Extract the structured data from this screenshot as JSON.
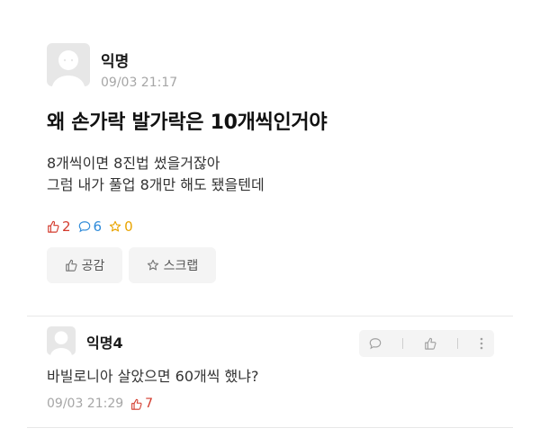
{
  "post": {
    "author": "익명",
    "date": "09/03 21:17",
    "title": "왜 손가락 발가락은 10개씩인거야",
    "body_lines": [
      "8개씩이면 8진법 썼을거잖아",
      "그럼 내가 풀업 8개만 해도 됐을텐데"
    ],
    "stats": {
      "likes": "2",
      "comments": "6",
      "scraps": "0"
    },
    "buttons": {
      "like_label": "공감",
      "scrap_label": "스크랩"
    }
  },
  "comment": {
    "author": "익명4",
    "text": "바빌로니아 살았으면 60개씩 했냐?",
    "date": "09/03 21:29",
    "likes": "7"
  },
  "colors": {
    "like": "#d33a2c",
    "comment": "#2f8bd9",
    "scrap": "#e9a400"
  }
}
